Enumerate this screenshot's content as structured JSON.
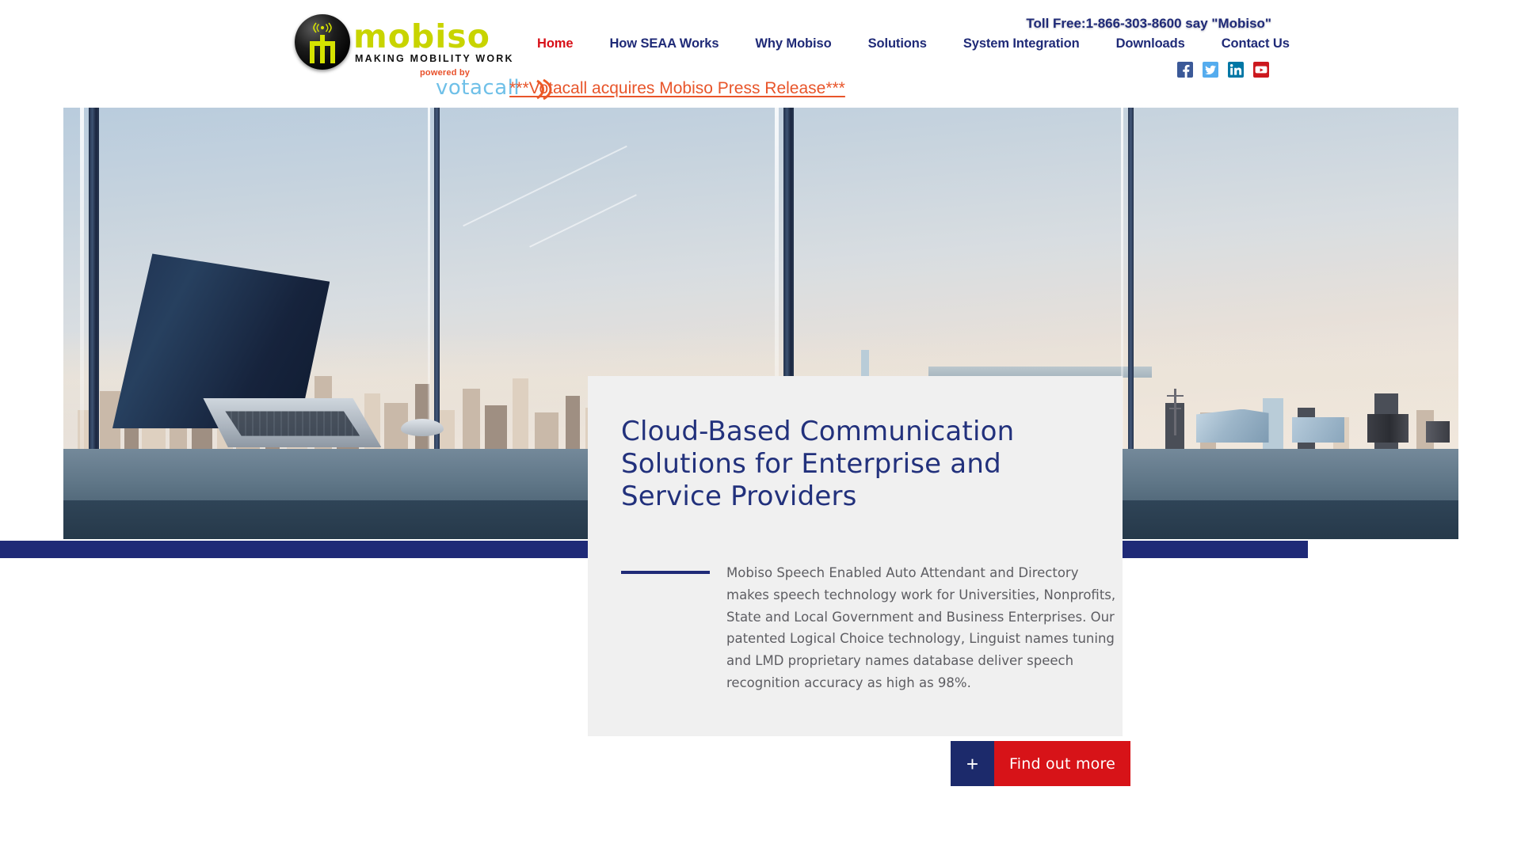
{
  "brand": {
    "name": "mobiso",
    "tagline": "MAKING MOBILITY WORK",
    "powered_by": "powered by",
    "parent": "votacall",
    "logo_colors": {
      "wordmark": "#c8d400",
      "badge": "#000000",
      "parent": "#6fc0e8",
      "powered": "#e8502a"
    }
  },
  "header": {
    "toll_free": "Toll Free:1-866-303-8600 say \"Mobiso\"",
    "nav": [
      {
        "label": "Home",
        "active": true
      },
      {
        "label": "How SEAA Works",
        "active": false
      },
      {
        "label": "Why Mobiso",
        "active": false
      },
      {
        "label": "Solutions",
        "active": false
      },
      {
        "label": "System Integration",
        "active": false
      },
      {
        "label": "Downloads",
        "active": false
      },
      {
        "label": "Contact Us",
        "active": false
      }
    ],
    "nav_active_color": "#d81018",
    "nav_color": "#1f2a77",
    "social": [
      {
        "name": "facebook-icon",
        "color": "#3b5998",
        "glyph": "f"
      },
      {
        "name": "twitter-icon",
        "color": "#55acee",
        "glyph": "t"
      },
      {
        "name": "linkedin-icon",
        "color": "#0077a5",
        "glyph": "in"
      },
      {
        "name": "youtube-icon",
        "color": "#cc181e",
        "glyph": "yt"
      }
    ]
  },
  "announcement": {
    "text": "***Votacall acquires Mobiso Press Release***",
    "color": "#e8552a"
  },
  "hero": {
    "image_alt": "Laptop on a desk in a high-rise office overlooking the New York City skyline with the Empire State Building",
    "accent_band_color": "#1f2a77"
  },
  "card": {
    "title": "Cloud-Based Communication Solutions for Enterprise and Service Providers",
    "title_color": "#22317c",
    "body": "Mobiso Speech Enabled Auto Attendant and Directory makes speech technology work for Universities, Nonprofits, State and Local Government and Business Enterprises. Our patented Logical Choice technology, Linguist names tuning and LMD proprietary names database deliver speech recognition accuracy as high as 98%.",
    "background": "#f0f0f0"
  },
  "cta": {
    "plus": "+",
    "label": "Find out more",
    "plus_bg": "#1c2a6b",
    "label_bg": "#d71318"
  }
}
